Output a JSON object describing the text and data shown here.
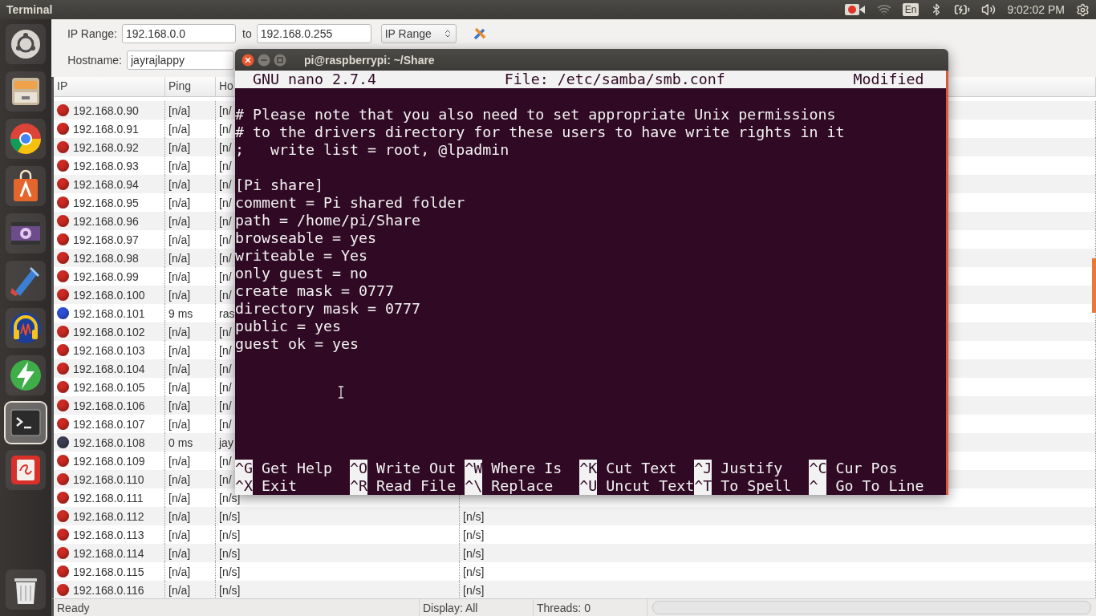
{
  "top_bar": {
    "title": "Terminal",
    "keyboard": "En",
    "clock": "9:02:02 PM"
  },
  "launcher": {
    "items": [
      {
        "kind": "dash",
        "selected": false
      },
      {
        "kind": "files",
        "selected": false
      },
      {
        "kind": "browser",
        "selected": false
      },
      {
        "kind": "store",
        "selected": false
      },
      {
        "kind": "video",
        "selected": false
      },
      {
        "kind": "tool",
        "selected": false
      },
      {
        "kind": "audio",
        "selected": false
      },
      {
        "kind": "bolt",
        "selected": false
      },
      {
        "kind": "terminal",
        "selected": true
      },
      {
        "kind": "doc",
        "selected": false
      }
    ]
  },
  "scanner": {
    "ip_range_label": "IP Range:",
    "from": "192.168.0.0",
    "to_label": "to",
    "to": "192.168.0.255",
    "mode": "IP Range",
    "hostname_label": "Hostname:",
    "hostname": "jayrajlappy",
    "columns": [
      "IP",
      "Ping",
      "Ho"
    ],
    "rows": [
      {
        "ip": "192.168.0.90",
        "ping": "[n/a]",
        "hostname": "[n/",
        "color": "#cc2a22"
      },
      {
        "ip": "192.168.0.91",
        "ping": "[n/a]",
        "hostname": "[n/",
        "color": "#cc2a22"
      },
      {
        "ip": "192.168.0.92",
        "ping": "[n/a]",
        "hostname": "[n/",
        "color": "#cc2a22"
      },
      {
        "ip": "192.168.0.93",
        "ping": "[n/a]",
        "hostname": "[n/",
        "color": "#cc2a22"
      },
      {
        "ip": "192.168.0.94",
        "ping": "[n/a]",
        "hostname": "[n/",
        "color": "#cc2a22"
      },
      {
        "ip": "192.168.0.95",
        "ping": "[n/a]",
        "hostname": "[n/",
        "color": "#cc2a22"
      },
      {
        "ip": "192.168.0.96",
        "ping": "[n/a]",
        "hostname": "[n/",
        "color": "#cc2a22"
      },
      {
        "ip": "192.168.0.97",
        "ping": "[n/a]",
        "hostname": "[n/",
        "color": "#cc2a22"
      },
      {
        "ip": "192.168.0.98",
        "ping": "[n/a]",
        "hostname": "[n/",
        "color": "#cc2a22"
      },
      {
        "ip": "192.168.0.99",
        "ping": "[n/a]",
        "hostname": "[n/",
        "color": "#cc2a22"
      },
      {
        "ip": "192.168.0.100",
        "ping": "[n/a]",
        "hostname": "[n/",
        "color": "#cc2a22"
      },
      {
        "ip": "192.168.0.101",
        "ping": "9 ms",
        "hostname": "ras",
        "color": "#2c4fd8"
      },
      {
        "ip": "192.168.0.102",
        "ping": "[n/a]",
        "hostname": "[n/",
        "color": "#cc2a22"
      },
      {
        "ip": "192.168.0.103",
        "ping": "[n/a]",
        "hostname": "[n/",
        "color": "#cc2a22"
      },
      {
        "ip": "192.168.0.104",
        "ping": "[n/a]",
        "hostname": "[n/",
        "color": "#cc2a22"
      },
      {
        "ip": "192.168.0.105",
        "ping": "[n/a]",
        "hostname": "[n/",
        "color": "#cc2a22"
      },
      {
        "ip": "192.168.0.106",
        "ping": "[n/a]",
        "hostname": "[n/",
        "color": "#cc2a22"
      },
      {
        "ip": "192.168.0.107",
        "ping": "[n/a]",
        "hostname": "[n/",
        "color": "#cc2a22"
      },
      {
        "ip": "192.168.0.108",
        "ping": "0 ms",
        "hostname": "jay",
        "color": "#3b3d52"
      },
      {
        "ip": "192.168.0.109",
        "ping": "[n/a]",
        "hostname": "[n/",
        "color": "#cc2a22"
      },
      {
        "ip": "192.168.0.110",
        "ping": "[n/a]",
        "hostname": "[n/",
        "color": "#cc2a22"
      },
      {
        "ip": "192.168.0.111",
        "ping": "[n/a]",
        "hostname": "[n/s]",
        "color": "#cc2a22"
      },
      {
        "ip": "192.168.0.112",
        "ping": "[n/a]",
        "hostname": "[n/s]",
        "column_4": "[n/s]",
        "color": "#cc2a22"
      },
      {
        "ip": "192.168.0.113",
        "ping": "[n/a]",
        "hostname": "[n/s]",
        "column_4": "[n/s]",
        "color": "#cc2a22"
      },
      {
        "ip": "192.168.0.114",
        "ping": "[n/a]",
        "hostname": "[n/s]",
        "column_4": "[n/s]",
        "color": "#cc2a22"
      },
      {
        "ip": "192.168.0.115",
        "ping": "[n/a]",
        "hostname": "[n/s]",
        "column_4": "[n/s]",
        "color": "#cc2a22"
      },
      {
        "ip": "192.168.0.116",
        "ping": "[n/a]",
        "hostname": "[n/s]",
        "column_4": "[n/s]",
        "color": "#cc2a22"
      }
    ],
    "status_bar": [
      "Ready",
      "Display: All",
      "Threads: 0"
    ],
    "progress": {
      "level": 0
    }
  },
  "terminal": {
    "title": "pi@raspberrypi: ~/Share",
    "nano_header": {
      "app": "GNU nano 2.7.4",
      "file": "File: /etc/samba/smb.conf",
      "status": "Modified"
    },
    "paragraphs": [
      [
        "# Please note that you also need to set appropriate Unix permissions",
        "# to the drivers directory for these users to have write rights in it",
        ";   write list = root, @lpadmin"
      ],
      [
        "[Pi share]",
        "comment = Pi shared folder",
        "path = /home/pi/Share",
        "browseable = yes",
        "writeable = Yes",
        "only guest = no",
        "create mask = 0777",
        "directory mask = 0777",
        "public = yes",
        "guest ok = yes"
      ]
    ],
    "shortcut_rows": [
      [
        {
          "key": "^G",
          "label": "Get Help"
        },
        {
          "key": "^O",
          "label": "Write Out"
        },
        {
          "key": "^W",
          "label": "Where Is"
        },
        {
          "key": "^K",
          "label": "Cut Text"
        },
        {
          "key": "^J",
          "label": "Justify"
        },
        {
          "key": "^C",
          "label": "Cur Pos"
        }
      ],
      [
        {
          "key": "^X",
          "label": "Exit"
        },
        {
          "key": "^R",
          "label": "Read File"
        },
        {
          "key": "^\\",
          "label": "Replace"
        },
        {
          "key": "^U",
          "label": "Uncut Text"
        },
        {
          "key": "^T",
          "label": "To Spell"
        },
        {
          "key": "^",
          "label": "Go To Line"
        }
      ]
    ]
  }
}
